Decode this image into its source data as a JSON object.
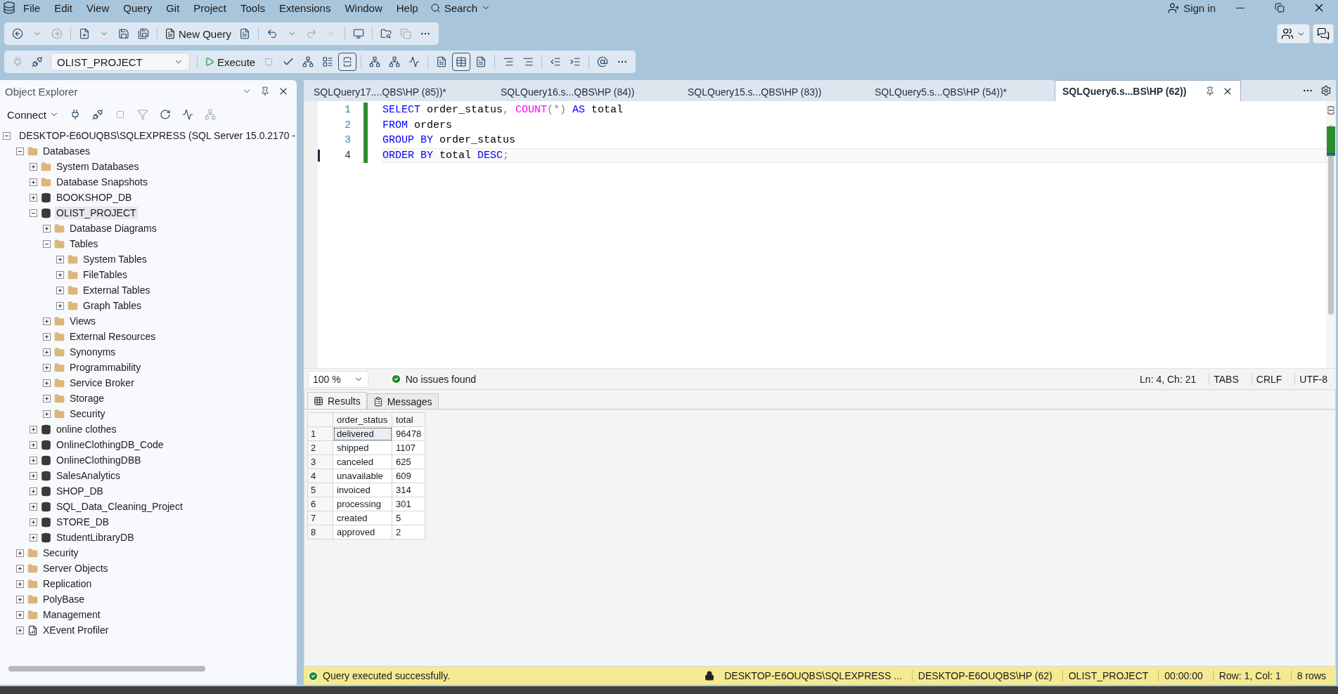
{
  "menu": [
    "File",
    "Edit",
    "View",
    "Query",
    "Git",
    "Project",
    "Tools",
    "Extensions",
    "Window",
    "Help"
  ],
  "search": {
    "label": "Search"
  },
  "sign_in": {
    "label": "Sign in"
  },
  "toolbar": {
    "new_query": "New Query",
    "database": "OLIST_PROJECT",
    "execute": "Execute"
  },
  "object_explorer": {
    "title": "Object Explorer",
    "connect": "Connect",
    "tree": [
      {
        "label": "DESKTOP-E6OUQBS\\SQLEXPRESS (SQL Server 15.0.2170 -",
        "kind": "server",
        "expanded": true,
        "selected": false,
        "children": [
          {
            "label": "Databases",
            "kind": "folder",
            "expanded": true,
            "selected": false,
            "children": [
              {
                "label": "System Databases",
                "kind": "folder",
                "expanded": false,
                "selected": false
              },
              {
                "label": "Database Snapshots",
                "kind": "folder",
                "expanded": false,
                "selected": false
              },
              {
                "label": "BOOKSHOP_DB",
                "kind": "database",
                "expanded": false,
                "selected": false
              },
              {
                "label": "OLIST_PROJECT",
                "kind": "database",
                "expanded": true,
                "selected": true,
                "children": [
                  {
                    "label": "Database Diagrams",
                    "kind": "folder",
                    "expanded": false,
                    "selected": false
                  },
                  {
                    "label": "Tables",
                    "kind": "folder",
                    "expanded": true,
                    "selected": false,
                    "children": [
                      {
                        "label": "System Tables",
                        "kind": "folder",
                        "expanded": false,
                        "selected": false
                      },
                      {
                        "label": "FileTables",
                        "kind": "folder",
                        "expanded": false,
                        "selected": false
                      },
                      {
                        "label": "External Tables",
                        "kind": "folder",
                        "expanded": false,
                        "selected": false
                      },
                      {
                        "label": "Graph Tables",
                        "kind": "folder",
                        "expanded": false,
                        "selected": false
                      }
                    ]
                  },
                  {
                    "label": "Views",
                    "kind": "folder",
                    "expanded": false,
                    "selected": false
                  },
                  {
                    "label": "External Resources",
                    "kind": "folder",
                    "expanded": false,
                    "selected": false
                  },
                  {
                    "label": "Synonyms",
                    "kind": "folder",
                    "expanded": false,
                    "selected": false
                  },
                  {
                    "label": "Programmability",
                    "kind": "folder",
                    "expanded": false,
                    "selected": false
                  },
                  {
                    "label": "Service Broker",
                    "kind": "folder",
                    "expanded": false,
                    "selected": false
                  },
                  {
                    "label": "Storage",
                    "kind": "folder",
                    "expanded": false,
                    "selected": false
                  },
                  {
                    "label": "Security",
                    "kind": "folder",
                    "expanded": false,
                    "selected": false
                  }
                ]
              },
              {
                "label": "online clothes",
                "kind": "database",
                "expanded": false,
                "selected": false
              },
              {
                "label": "OnlineClothingDB_Code",
                "kind": "database",
                "expanded": false,
                "selected": false
              },
              {
                "label": "OnlineClothingDBB",
                "kind": "database",
                "expanded": false,
                "selected": false
              },
              {
                "label": "SalesAnalytics",
                "kind": "database",
                "expanded": false,
                "selected": false
              },
              {
                "label": "SHOP_DB",
                "kind": "database",
                "expanded": false,
                "selected": false
              },
              {
                "label": "SQL_Data_Cleaning_Project",
                "kind": "database",
                "expanded": false,
                "selected": false
              },
              {
                "label": "STORE_DB",
                "kind": "database",
                "expanded": false,
                "selected": false
              },
              {
                "label": "StudentLibraryDB",
                "kind": "database",
                "expanded": false,
                "selected": false
              }
            ]
          },
          {
            "label": "Security",
            "kind": "folder",
            "expanded": false,
            "selected": false
          },
          {
            "label": "Server Objects",
            "kind": "folder",
            "expanded": false,
            "selected": false
          },
          {
            "label": "Replication",
            "kind": "folder",
            "expanded": false,
            "selected": false
          },
          {
            "label": "PolyBase",
            "kind": "folder",
            "expanded": false,
            "selected": false
          },
          {
            "label": "Management",
            "kind": "folder",
            "expanded": false,
            "selected": false
          },
          {
            "label": "XEvent Profiler",
            "kind": "xevent",
            "expanded": false,
            "selected": false
          }
        ]
      }
    ]
  },
  "editor_tabs": [
    {
      "label": "SQLQuery17....QBS\\HP (85))*",
      "selected": false
    },
    {
      "label": "SQLQuery16.s...QBS\\HP (84))",
      "selected": false
    },
    {
      "label": "SQLQuery15.s...QBS\\HP (83))",
      "selected": false
    },
    {
      "label": "SQLQuery5.s...QBS\\HP (54))*",
      "selected": false
    },
    {
      "label": "SQLQuery6.s...BS\\HP (62))",
      "selected": true
    }
  ],
  "code": [
    {
      "number": "1",
      "current": false,
      "tokens": [
        {
          "text": "SELECT",
          "kind": "keyword"
        },
        {
          "text": " order_status",
          "kind": "plain"
        },
        {
          "text": ", ",
          "kind": "punct"
        },
        {
          "text": "COUNT",
          "kind": "function"
        },
        {
          "text": "(*) ",
          "kind": "punct"
        },
        {
          "text": "AS",
          "kind": "keyword"
        },
        {
          "text": " total",
          "kind": "plain"
        }
      ]
    },
    {
      "number": "2",
      "current": false,
      "tokens": [
        {
          "text": "FROM",
          "kind": "keyword"
        },
        {
          "text": " orders",
          "kind": "plain"
        }
      ]
    },
    {
      "number": "3",
      "current": false,
      "tokens": [
        {
          "text": "GROUP BY",
          "kind": "keyword"
        },
        {
          "text": " order_status",
          "kind": "plain"
        }
      ]
    },
    {
      "number": "4",
      "current": true,
      "tokens": [
        {
          "text": "ORDER BY",
          "kind": "keyword"
        },
        {
          "text": " total ",
          "kind": "plain"
        },
        {
          "text": "DESC",
          "kind": "keyword"
        },
        {
          "text": ";",
          "kind": "punct"
        }
      ]
    }
  ],
  "editor_status": {
    "zoom": "100 %",
    "issues": "No issues found",
    "position": "Ln: 4, Ch: 21",
    "items": [
      "TABS",
      "CRLF",
      "UTF-8"
    ]
  },
  "result_tabs": [
    {
      "label": "Results",
      "kind": "grid",
      "selected": true
    },
    {
      "label": "Messages",
      "kind": "messages",
      "selected": false
    }
  ],
  "grid": {
    "columns": [
      "order_status",
      "total"
    ],
    "rows": [
      {
        "number": "1",
        "selected": true,
        "cells": [
          "delivered",
          "96478"
        ]
      },
      {
        "number": "2",
        "selected": false,
        "cells": [
          "shipped",
          "1107"
        ]
      },
      {
        "number": "3",
        "selected": false,
        "cells": [
          "canceled",
          "625"
        ]
      },
      {
        "number": "4",
        "selected": false,
        "cells": [
          "unavailable",
          "609"
        ]
      },
      {
        "number": "5",
        "selected": false,
        "cells": [
          "invoiced",
          "314"
        ]
      },
      {
        "number": "6",
        "selected": false,
        "cells": [
          "processing",
          "301"
        ]
      },
      {
        "number": "7",
        "selected": false,
        "cells": [
          "created",
          "5"
        ]
      },
      {
        "number": "8",
        "selected": false,
        "cells": [
          "approved",
          "2"
        ]
      }
    ]
  },
  "status_bar": {
    "message": "Query executed successfully.",
    "items": [
      "DESKTOP-E6OUQBS\\SQLEXPRESS ...",
      "DESKTOP-E6OUQBS\\HP (62)",
      "OLIST_PROJECT",
      "00:00:00",
      "Row: 1, Col: 1",
      "8 rows"
    ]
  }
}
